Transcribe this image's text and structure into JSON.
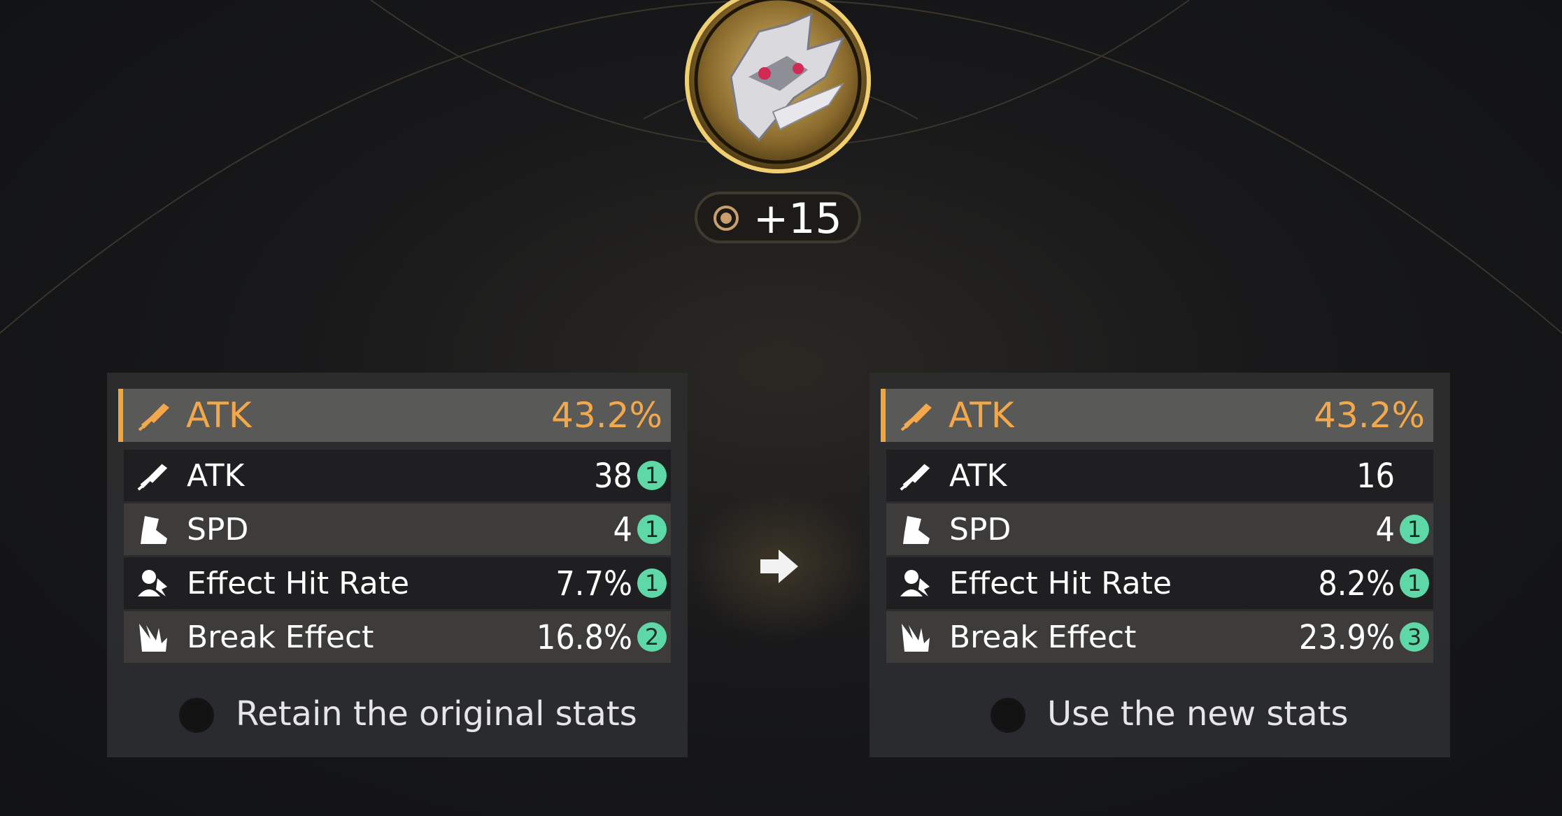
{
  "relic": {
    "level": "+15",
    "image": "relic-helmet-icon"
  },
  "left": {
    "main_stat": {
      "name": "ATK",
      "value": "43.2%",
      "icon": "sword-icon"
    },
    "sub_stats": [
      {
        "name": "ATK",
        "value": "38",
        "rolls": "1",
        "icon": "sword-icon"
      },
      {
        "name": "SPD",
        "value": "4",
        "rolls": "1",
        "icon": "boot-icon"
      },
      {
        "name": "Effect Hit Rate",
        "value": "7.7%",
        "rolls": "1",
        "icon": "effect-hit-icon"
      },
      {
        "name": "Break Effect",
        "value": "16.8%",
        "rolls": "2",
        "icon": "break-icon"
      }
    ],
    "option_label": "Retain the original stats"
  },
  "right": {
    "main_stat": {
      "name": "ATK",
      "value": "43.2%",
      "icon": "sword-icon"
    },
    "sub_stats": [
      {
        "name": "ATK",
        "value": "16",
        "rolls": "",
        "icon": "sword-icon"
      },
      {
        "name": "SPD",
        "value": "4",
        "rolls": "1",
        "icon": "boot-icon"
      },
      {
        "name": "Effect Hit Rate",
        "value": "8.2%",
        "rolls": "1",
        "icon": "effect-hit-icon"
      },
      {
        "name": "Break Effect",
        "value": "23.9%",
        "rolls": "3",
        "icon": "break-icon"
      }
    ],
    "option_label": "Use the new stats"
  },
  "colors": {
    "accent": "#f5a84a",
    "roll_badge": "#5fd8a8"
  }
}
